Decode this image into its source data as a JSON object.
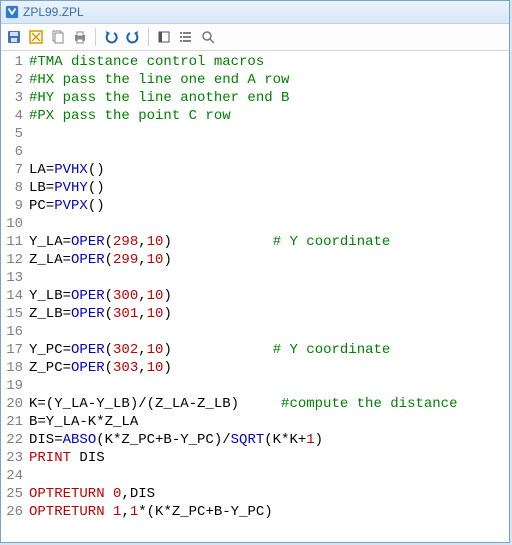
{
  "window": {
    "title": "ZPL99.ZPL"
  },
  "toolbar_icons": {
    "save": "save",
    "clear": "clear",
    "copy": "copy",
    "print": "print",
    "undo": "undo",
    "redo": "redo",
    "mode1": "mode",
    "mode2": "list",
    "search": "search"
  },
  "lines": [
    {
      "n": "1",
      "seg": [
        {
          "c": "c-kw",
          "t": "#TMA distance control macros"
        }
      ]
    },
    {
      "n": "2",
      "seg": [
        {
          "c": "c-kw",
          "t": "#HX pass the line one end A row"
        }
      ]
    },
    {
      "n": "3",
      "seg": [
        {
          "c": "c-kw",
          "t": "#HY pass the line another end B"
        }
      ]
    },
    {
      "n": "4",
      "seg": [
        {
          "c": "c-kw",
          "t": "#PX pass the point C row"
        }
      ]
    },
    {
      "n": "5",
      "seg": [
        {
          "c": "c-plain",
          "t": ""
        }
      ]
    },
    {
      "n": "6",
      "seg": [
        {
          "c": "c-plain",
          "t": ""
        }
      ]
    },
    {
      "n": "7",
      "seg": [
        {
          "c": "c-plain",
          "t": "LA="
        },
        {
          "c": "c-fn",
          "t": "PVHX"
        },
        {
          "c": "c-plain",
          "t": "()"
        }
      ]
    },
    {
      "n": "8",
      "seg": [
        {
          "c": "c-plain",
          "t": "LB="
        },
        {
          "c": "c-fn",
          "t": "PVHY"
        },
        {
          "c": "c-plain",
          "t": "()"
        }
      ]
    },
    {
      "n": "9",
      "seg": [
        {
          "c": "c-plain",
          "t": "PC="
        },
        {
          "c": "c-fn",
          "t": "PVPX"
        },
        {
          "c": "c-plain",
          "t": "()"
        }
      ]
    },
    {
      "n": "10",
      "seg": [
        {
          "c": "c-plain",
          "t": ""
        }
      ]
    },
    {
      "n": "11",
      "seg": [
        {
          "c": "c-plain",
          "t": "Y_LA="
        },
        {
          "c": "c-fn",
          "t": "OPER"
        },
        {
          "c": "c-plain",
          "t": "("
        },
        {
          "c": "c-num",
          "t": "298"
        },
        {
          "c": "c-plain",
          "t": ","
        },
        {
          "c": "c-num",
          "t": "10"
        },
        {
          "c": "c-plain",
          "t": ")            "
        },
        {
          "c": "c-kw",
          "t": "# Y coordinate"
        }
      ]
    },
    {
      "n": "12",
      "seg": [
        {
          "c": "c-plain",
          "t": "Z_LA="
        },
        {
          "c": "c-fn",
          "t": "OPER"
        },
        {
          "c": "c-plain",
          "t": "("
        },
        {
          "c": "c-num",
          "t": "299"
        },
        {
          "c": "c-plain",
          "t": ","
        },
        {
          "c": "c-num",
          "t": "10"
        },
        {
          "c": "c-plain",
          "t": ")"
        }
      ]
    },
    {
      "n": "13",
      "seg": [
        {
          "c": "c-plain",
          "t": ""
        }
      ]
    },
    {
      "n": "14",
      "seg": [
        {
          "c": "c-plain",
          "t": "Y_LB="
        },
        {
          "c": "c-fn",
          "t": "OPER"
        },
        {
          "c": "c-plain",
          "t": "("
        },
        {
          "c": "c-num",
          "t": "300"
        },
        {
          "c": "c-plain",
          "t": ","
        },
        {
          "c": "c-num",
          "t": "10"
        },
        {
          "c": "c-plain",
          "t": ")"
        }
      ]
    },
    {
      "n": "15",
      "seg": [
        {
          "c": "c-plain",
          "t": "Z_LB="
        },
        {
          "c": "c-fn",
          "t": "OPER"
        },
        {
          "c": "c-plain",
          "t": "("
        },
        {
          "c": "c-num",
          "t": "301"
        },
        {
          "c": "c-plain",
          "t": ","
        },
        {
          "c": "c-num",
          "t": "10"
        },
        {
          "c": "c-plain",
          "t": ")"
        }
      ]
    },
    {
      "n": "16",
      "seg": [
        {
          "c": "c-plain",
          "t": ""
        }
      ]
    },
    {
      "n": "17",
      "seg": [
        {
          "c": "c-plain",
          "t": "Y_PC="
        },
        {
          "c": "c-fn",
          "t": "OPER"
        },
        {
          "c": "c-plain",
          "t": "("
        },
        {
          "c": "c-num",
          "t": "302"
        },
        {
          "c": "c-plain",
          "t": ","
        },
        {
          "c": "c-num",
          "t": "10"
        },
        {
          "c": "c-plain",
          "t": ")            "
        },
        {
          "c": "c-kw",
          "t": "# Y coordinate"
        }
      ]
    },
    {
      "n": "18",
      "seg": [
        {
          "c": "c-plain",
          "t": "Z_PC="
        },
        {
          "c": "c-fn",
          "t": "OPER"
        },
        {
          "c": "c-plain",
          "t": "("
        },
        {
          "c": "c-num",
          "t": "303"
        },
        {
          "c": "c-plain",
          "t": ","
        },
        {
          "c": "c-num",
          "t": "10"
        },
        {
          "c": "c-plain",
          "t": ")"
        }
      ]
    },
    {
      "n": "19",
      "seg": [
        {
          "c": "c-plain",
          "t": ""
        }
      ]
    },
    {
      "n": "20",
      "seg": [
        {
          "c": "c-plain",
          "t": "K=(Y_LA-Y_LB)/(Z_LA-Z_LB)     "
        },
        {
          "c": "c-kw",
          "t": "#compute the distance"
        }
      ]
    },
    {
      "n": "21",
      "seg": [
        {
          "c": "c-plain",
          "t": "B=Y_LA-K*Z_LA"
        }
      ]
    },
    {
      "n": "22",
      "seg": [
        {
          "c": "c-plain",
          "t": "DIS="
        },
        {
          "c": "c-fn",
          "t": "ABSO"
        },
        {
          "c": "c-plain",
          "t": "(K*Z_PC+B-Y_PC)/"
        },
        {
          "c": "c-fn",
          "t": "SQRT"
        },
        {
          "c": "c-plain",
          "t": "(K*K+"
        },
        {
          "c": "c-num",
          "t": "1"
        },
        {
          "c": "c-plain",
          "t": ")"
        }
      ]
    },
    {
      "n": "23",
      "seg": [
        {
          "c": "c-num",
          "t": "PRINT"
        },
        {
          "c": "c-plain",
          "t": " DIS"
        }
      ]
    },
    {
      "n": "24",
      "seg": [
        {
          "c": "c-plain",
          "t": ""
        }
      ]
    },
    {
      "n": "25",
      "seg": [
        {
          "c": "c-num",
          "t": "OPTRETURN"
        },
        {
          "c": "c-plain",
          "t": " "
        },
        {
          "c": "c-num",
          "t": "0"
        },
        {
          "c": "c-plain",
          "t": ",DIS"
        }
      ]
    },
    {
      "n": "26",
      "seg": [
        {
          "c": "c-num",
          "t": "OPTRETURN"
        },
        {
          "c": "c-plain",
          "t": " "
        },
        {
          "c": "c-num",
          "t": "1"
        },
        {
          "c": "c-plain",
          "t": ","
        },
        {
          "c": "c-num",
          "t": "1"
        },
        {
          "c": "c-plain",
          "t": "*(K*Z_PC+B-Y_PC)"
        }
      ]
    }
  ]
}
